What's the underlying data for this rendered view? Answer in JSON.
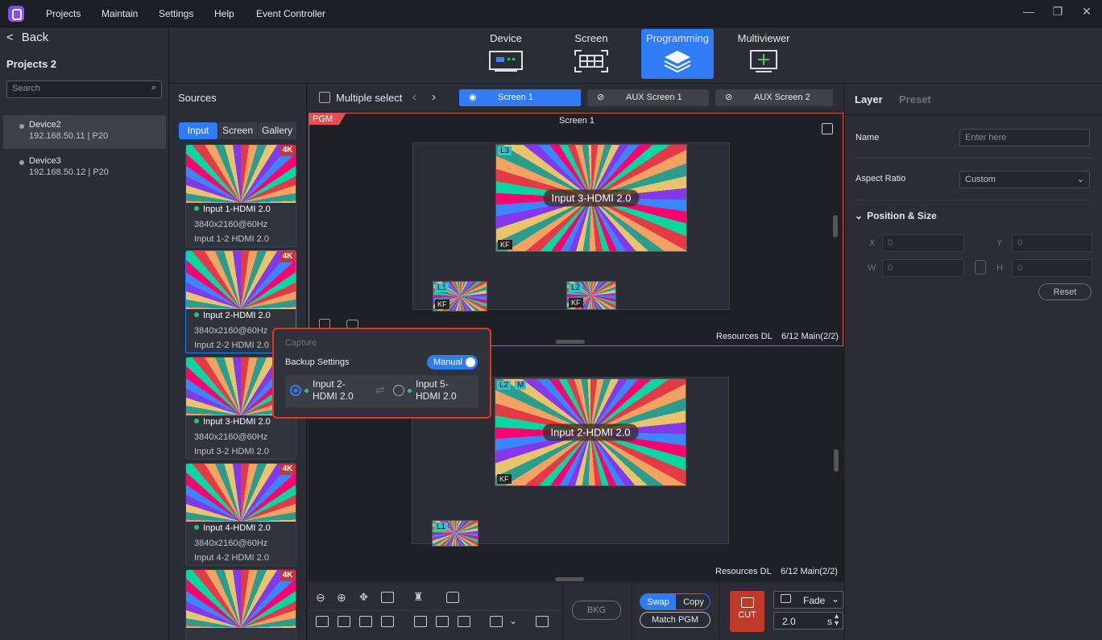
{
  "menubar": {
    "items": [
      "Projects",
      "Maintain",
      "Settings",
      "Help",
      "Event Controller"
    ]
  },
  "left": {
    "back_label": "Back",
    "project_title": "Projects 2",
    "search_placeholder": "Search",
    "devices": [
      {
        "name": "Device2",
        "info": "192.168.50.11 | P20",
        "selected": true
      },
      {
        "name": "Device3",
        "info": "192.168.50.12 | P20",
        "selected": false
      }
    ]
  },
  "toptabs": [
    {
      "label": "Device"
    },
    {
      "label": "Screen"
    },
    {
      "label": "Programming",
      "active": true
    },
    {
      "label": "Multiviewer"
    }
  ],
  "sources": {
    "title": "Sources",
    "tabs": [
      "Input",
      "Screen",
      "Gallery"
    ],
    "cards": [
      {
        "badge": "4K",
        "name": "Input 1-HDMI 2.0",
        "res": "3840x2160@60Hz",
        "port": "Input 1-2  HDMI 2.0"
      },
      {
        "badge": "4K",
        "name": "Input 2-HDMI 2.0",
        "res": "3840x2160@60Hz",
        "port": "Input 2-2  HDMI 2.0"
      },
      {
        "badge": "4K",
        "name": "Input 3-HDMI 2.0",
        "res": "3840x2160@60Hz",
        "port": "Input 3-2  HDMI 2.0"
      },
      {
        "badge": "4K",
        "name": "Input 4-HDMI 2.0",
        "res": "3840x2160@60Hz",
        "port": "Input 4-2  HDMI 2.0"
      },
      {
        "badge": "4K",
        "name": "",
        "res": "",
        "port": ""
      }
    ]
  },
  "center": {
    "multiple_select": "Multiple select",
    "screens": [
      "Screen 1",
      "AUX Screen 1",
      "AUX Screen 2"
    ],
    "pgm": {
      "tag": "PGM",
      "title": "Screen 1",
      "resources": "Resources DL",
      "main": "6/12 Main(2/2)",
      "big_layer": {
        "tag": "L3",
        "name": "Input 3-HDMI 2.0",
        "kf": "KF"
      },
      "small_layers": [
        {
          "tag": "L1",
          "kf": "KF"
        },
        {
          "tag": "L2",
          "kf": "KF"
        }
      ]
    },
    "pvw": {
      "resources": "Resources DL",
      "main": "6/12 Main(2/2)",
      "big_layer": {
        "tag": "L2",
        "tag2": "M",
        "name": "Input 2-HDMI 2.0",
        "kf": "KF"
      },
      "small_layers": [
        {
          "tag": "L1"
        }
      ]
    }
  },
  "popup": {
    "title": "Capture",
    "backup_label": "Backup Settings",
    "mode": "Manual",
    "input_a": "Input 2-\nHDMI 2.0",
    "input_b": "Input 5-\nHDMI 2.0"
  },
  "right": {
    "tabs": [
      "Layer",
      "Preset"
    ],
    "name_label": "Name",
    "name_placeholder": "Enter here",
    "aspect_label": "Aspect Ratio",
    "aspect_value": "Custom",
    "pos_title": "Position & Size",
    "x_label": "X",
    "y_label": "Y",
    "w_label": "W",
    "h_label": "H",
    "x": "0",
    "y": "0",
    "w": "0",
    "h": "0",
    "reset": "Reset"
  },
  "bottom": {
    "bkg": "BKG",
    "swap": "Swap",
    "copy": "Copy",
    "match": "Match PGM",
    "cut": "CUT",
    "transition": "Fade",
    "duration": "2.0",
    "unit": "s"
  }
}
